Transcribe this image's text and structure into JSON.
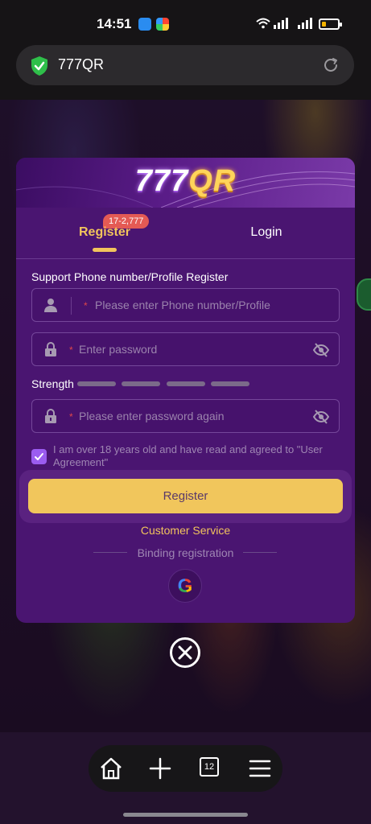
{
  "status_bar": {
    "time": "14:51"
  },
  "browser": {
    "url": "777QR"
  },
  "modal": {
    "logo_part1": "777",
    "logo_part2": "QR",
    "tabs": {
      "register_label": "Register",
      "register_badge": "17-2,777",
      "login_label": "Login"
    },
    "section_title": "Support Phone number/Profile Register",
    "fields": {
      "phone_placeholder": "Please enter Phone number/Profile",
      "password_placeholder": "Enter password",
      "password_again_placeholder": "Please enter password again"
    },
    "strength_label": "Strength",
    "agreement_text": "I am over 18 years old and have read and agreed to \"User Agreement\"",
    "agreement_checked": true,
    "register_button": "Register",
    "customer_service": "Customer Service",
    "binding_text": "Binding registration",
    "google_letter": "G"
  },
  "bottom_nav": {
    "tab_count": "12"
  },
  "colors": {
    "modal_bg": "#4a1571",
    "accent_gold": "#f2c45c",
    "checkbox_purple": "#9b5cf0",
    "badge_red": "#e45a54"
  }
}
